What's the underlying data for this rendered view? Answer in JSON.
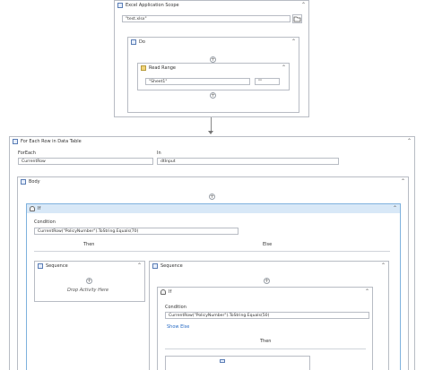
{
  "excel_scope": {
    "title": "Excel Application Scope",
    "path_value": "\"test.xlsx\"",
    "folder_icon": "folder-icon"
  },
  "do_seq": {
    "title": "Do"
  },
  "read_range": {
    "title": "Read Range",
    "sheet_value": "\"Sheet1\"",
    "range_value": "\"\""
  },
  "for_each": {
    "title": "For Each Row in Data Table",
    "foreach_label": "ForEach",
    "foreach_value": "CurrentRow",
    "in_label": "In",
    "in_value": "dtInput"
  },
  "body": {
    "title": "Body"
  },
  "if_outer": {
    "title": "If",
    "condition_label": "Condition",
    "condition_value": "CurrentRow(\"PolicyNumber\").ToString.Equals(70)",
    "then_label": "Then",
    "else_label": "Else"
  },
  "then_sequence": {
    "title": "Sequence",
    "drop_text": "Drop Activity Here"
  },
  "else_sequence": {
    "title": "Sequence"
  },
  "if_inner": {
    "title": "If",
    "condition_label": "Condition",
    "condition_value": "CurrentRow(\"PolicyNumber\").ToString.Equals(50)",
    "show_else": "Show Else",
    "then_label": "Then"
  },
  "icons": {
    "collapse": "⌃",
    "plus": "+",
    "chevron": "⌄"
  }
}
